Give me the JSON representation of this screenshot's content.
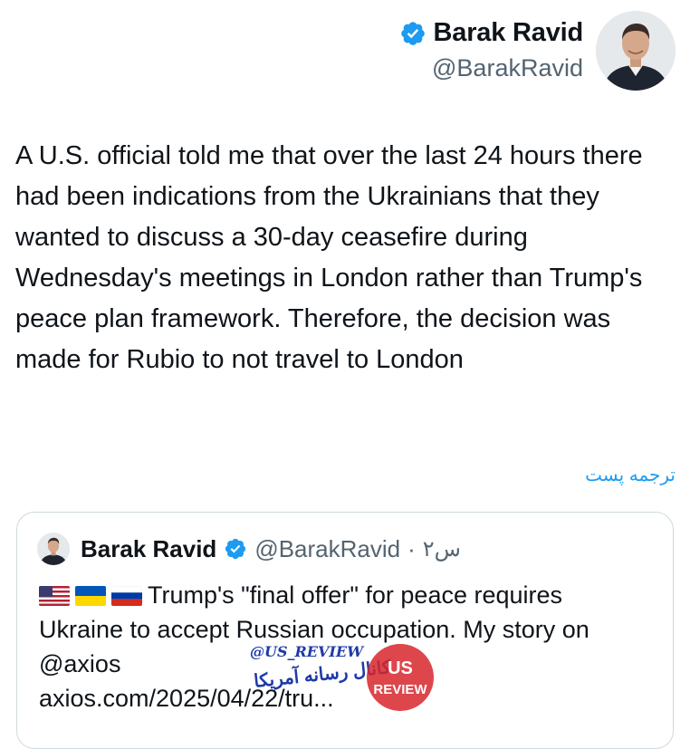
{
  "author": {
    "display_name": "Barak Ravid",
    "handle": "@BarakRavid",
    "verified": true
  },
  "tweet": {
    "text": "A U.S. official told me that over the last 24 hours there had been indications from the Ukrainians that they wanted to discuss a 30-day ceasefire during Wednesday's meetings in London rather than Trump's peace plan framework. Therefore, the decision was made for Rubio to not travel to London",
    "translate_label": "ترجمه پست"
  },
  "quoted": {
    "display_name": "Barak Ravid",
    "handle": "@BarakRavid",
    "separator": "·",
    "time": "۲س",
    "flags": [
      "us-flag-icon",
      "ukraine-flag-icon",
      "russia-flag-icon"
    ],
    "text_line1": "Trump's \"final offer\" for peace requires",
    "text_line2": "Ukraine to accept Russian occupation. My story on",
    "text_line3": "@axios",
    "link": "axios.com/2025/04/22/tru..."
  },
  "watermark": {
    "tag": "@US_REVIEW",
    "persian": "کانال رسانه آمریکا",
    "logo_line1": "US",
    "logo_line2": "REVIEW"
  },
  "colors": {
    "accent": "#1d9bf0",
    "text": "#0f1419",
    "secondary": "#536471",
    "border": "#cfd9de",
    "watermark_red": "#d7262c",
    "watermark_blue": "#1f3aa8"
  }
}
